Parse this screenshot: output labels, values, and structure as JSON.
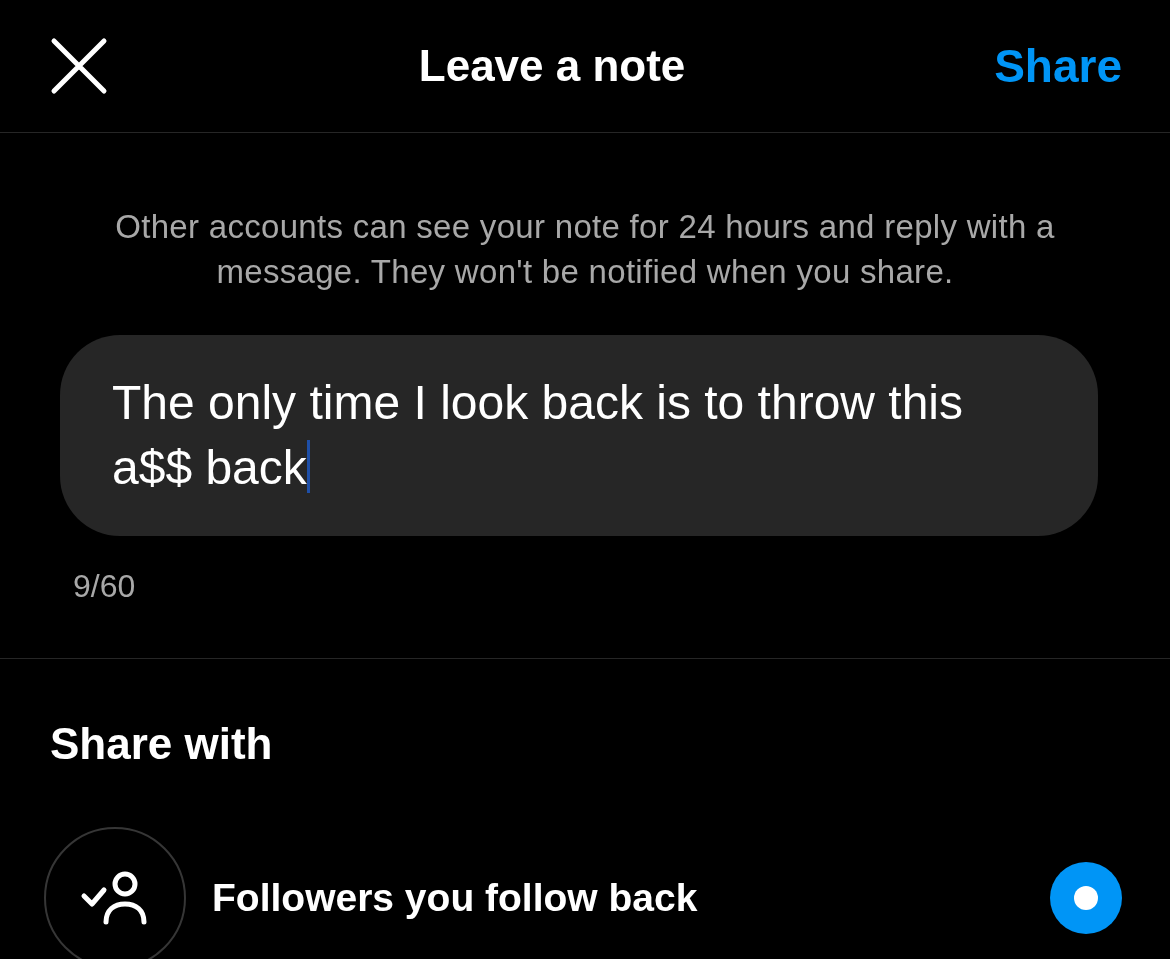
{
  "header": {
    "title": "Leave a note",
    "action": "Share"
  },
  "description": "Other accounts can see your note for 24 hours and reply with a message. They won't be notified when you share.",
  "note": {
    "value": "The only time I look back is to throw this a$$ back",
    "counter": "9/60"
  },
  "share_with": {
    "heading": "Share with",
    "options": [
      {
        "label": "Followers you follow back",
        "selected": true
      }
    ]
  }
}
